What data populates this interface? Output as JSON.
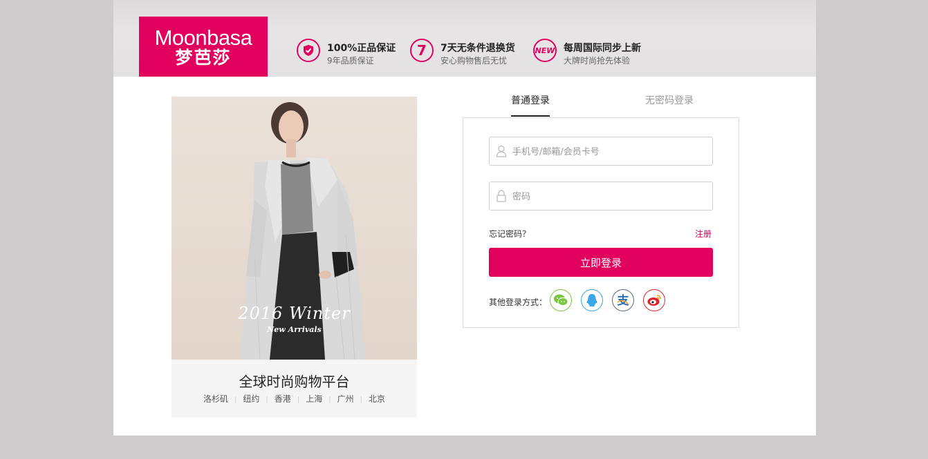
{
  "brand": {
    "name_en": "Moonbasa",
    "name_cn": "梦芭莎",
    "color": "#e2005f"
  },
  "features": [
    {
      "icon": "shield-check-icon",
      "badge": "",
      "title": "100%正品保证",
      "subtitle": "9年品质保证"
    },
    {
      "icon": "seven-days-icon",
      "badge": "7",
      "title": "7天无条件退换货",
      "subtitle": "安心购物售后无忧"
    },
    {
      "icon": "new-badge-icon",
      "badge": "NEW",
      "title": "每周国际同步上新",
      "subtitle": "大牌时尚抢先体验"
    }
  ],
  "promo": {
    "overlay_title": "2016 Winter",
    "overlay_subtitle": "New Arrivals",
    "title": "全球时尚购物平台",
    "cities": [
      "洛杉矶",
      "纽约",
      "香港",
      "上海",
      "广州",
      "北京"
    ]
  },
  "login": {
    "tabs": [
      {
        "label": "普通登录",
        "active": true
      },
      {
        "label": "无密码登录",
        "active": false
      }
    ],
    "account_placeholder": "手机号/邮箱/会员卡号",
    "password_placeholder": "密码",
    "forgot_label": "忘记密码？",
    "register_label": "注册",
    "submit_label": "立即登录",
    "social_label": "其他登录方式：",
    "social": [
      {
        "icon": "wechat-icon",
        "color": "#7bc540"
      },
      {
        "icon": "qq-icon",
        "color": "#39a7e8"
      },
      {
        "icon": "alipay-icon",
        "color": "#2a6fb6"
      },
      {
        "icon": "weibo-icon",
        "color": "#e0232b"
      }
    ]
  }
}
